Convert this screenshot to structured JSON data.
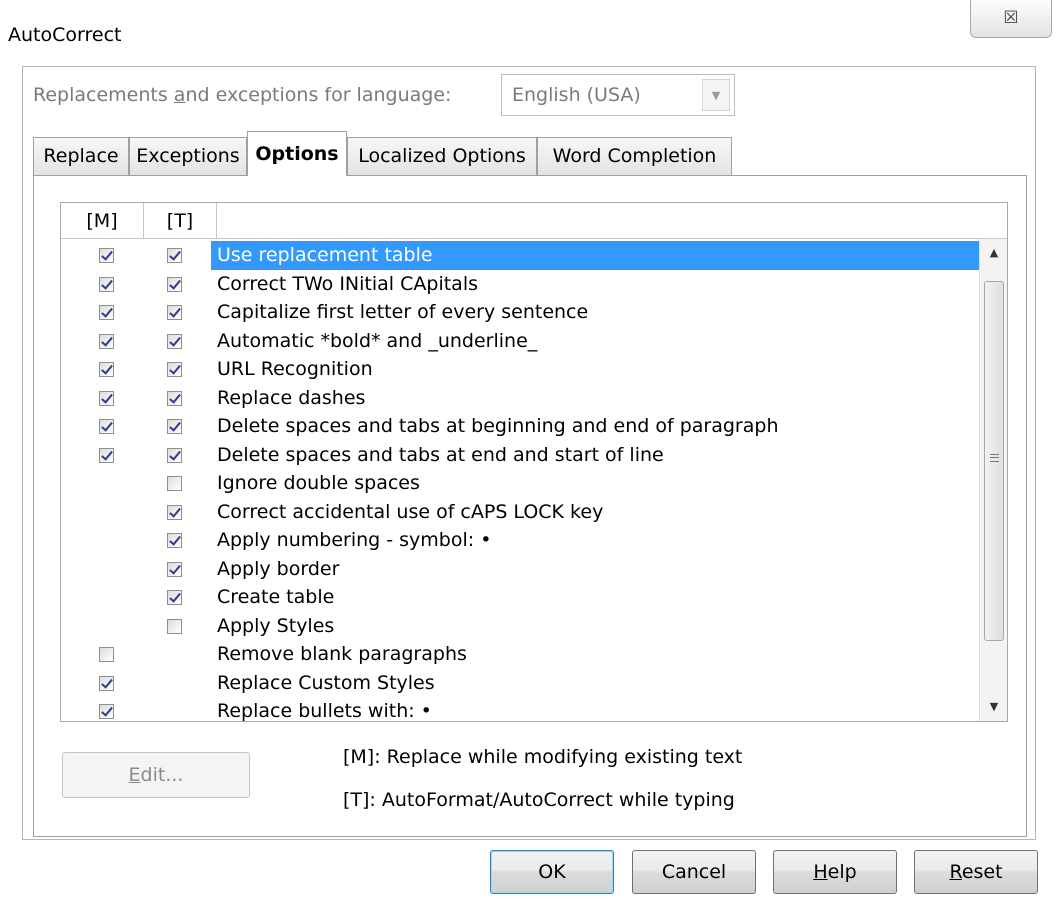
{
  "window": {
    "title": "AutoCorrect",
    "close_glyph": "☒"
  },
  "language": {
    "label_before": "Replacements ",
    "label_mnemonic": "a",
    "label_after": "nd exceptions for language:",
    "value": "English (USA)"
  },
  "tabs": [
    {
      "label": "Replace",
      "active": false
    },
    {
      "label": "Exceptions",
      "active": false
    },
    {
      "label": "Options",
      "active": true
    },
    {
      "label": "Localized Options",
      "active": false
    },
    {
      "label": "Word Completion",
      "active": false
    }
  ],
  "grid": {
    "headers": {
      "m": "[M]",
      "t": "[T]",
      "label": ""
    },
    "rows": [
      {
        "label": "Use replacement table",
        "m": true,
        "t": true,
        "selected": true
      },
      {
        "label": "Correct TWo INitial CApitals",
        "m": true,
        "t": true
      },
      {
        "label": "Capitalize first letter of every sentence",
        "m": true,
        "t": true
      },
      {
        "label": "Automatic *bold* and _underline_",
        "m": true,
        "t": true
      },
      {
        "label": "URL Recognition",
        "m": true,
        "t": true
      },
      {
        "label": "Replace dashes",
        "m": true,
        "t": true
      },
      {
        "label": "Delete spaces and tabs at beginning and end of paragraph",
        "m": true,
        "t": true
      },
      {
        "label": "Delete spaces and tabs at end and start of line",
        "m": true,
        "t": true
      },
      {
        "label": "Ignore double spaces",
        "m": null,
        "t": false
      },
      {
        "label": "Correct accidental use of cAPS LOCK key",
        "m": null,
        "t": true
      },
      {
        "label": "Apply numbering - symbol: •",
        "m": null,
        "t": true
      },
      {
        "label": "Apply border",
        "m": null,
        "t": true
      },
      {
        "label": "Create table",
        "m": null,
        "t": true
      },
      {
        "label": "Apply Styles",
        "m": null,
        "t": false
      },
      {
        "label": "Remove blank paragraphs",
        "m": false,
        "t": null
      },
      {
        "label": "Replace Custom Styles",
        "m": true,
        "t": null
      },
      {
        "label": "Replace bullets with: •",
        "m": true,
        "t": null
      }
    ]
  },
  "edit_button": {
    "mnemonic": "E",
    "rest": "dit..."
  },
  "legend": {
    "m": "[M]: Replace while modifying existing text",
    "t": "[T]: AutoFormat/AutoCorrect while typing"
  },
  "buttons": {
    "ok": {
      "label": "OK"
    },
    "cancel": {
      "label": "Cancel"
    },
    "help": {
      "mnemonic": "H",
      "rest": "elp"
    },
    "reset": {
      "mnemonic": "R",
      "rest": "eset"
    }
  }
}
